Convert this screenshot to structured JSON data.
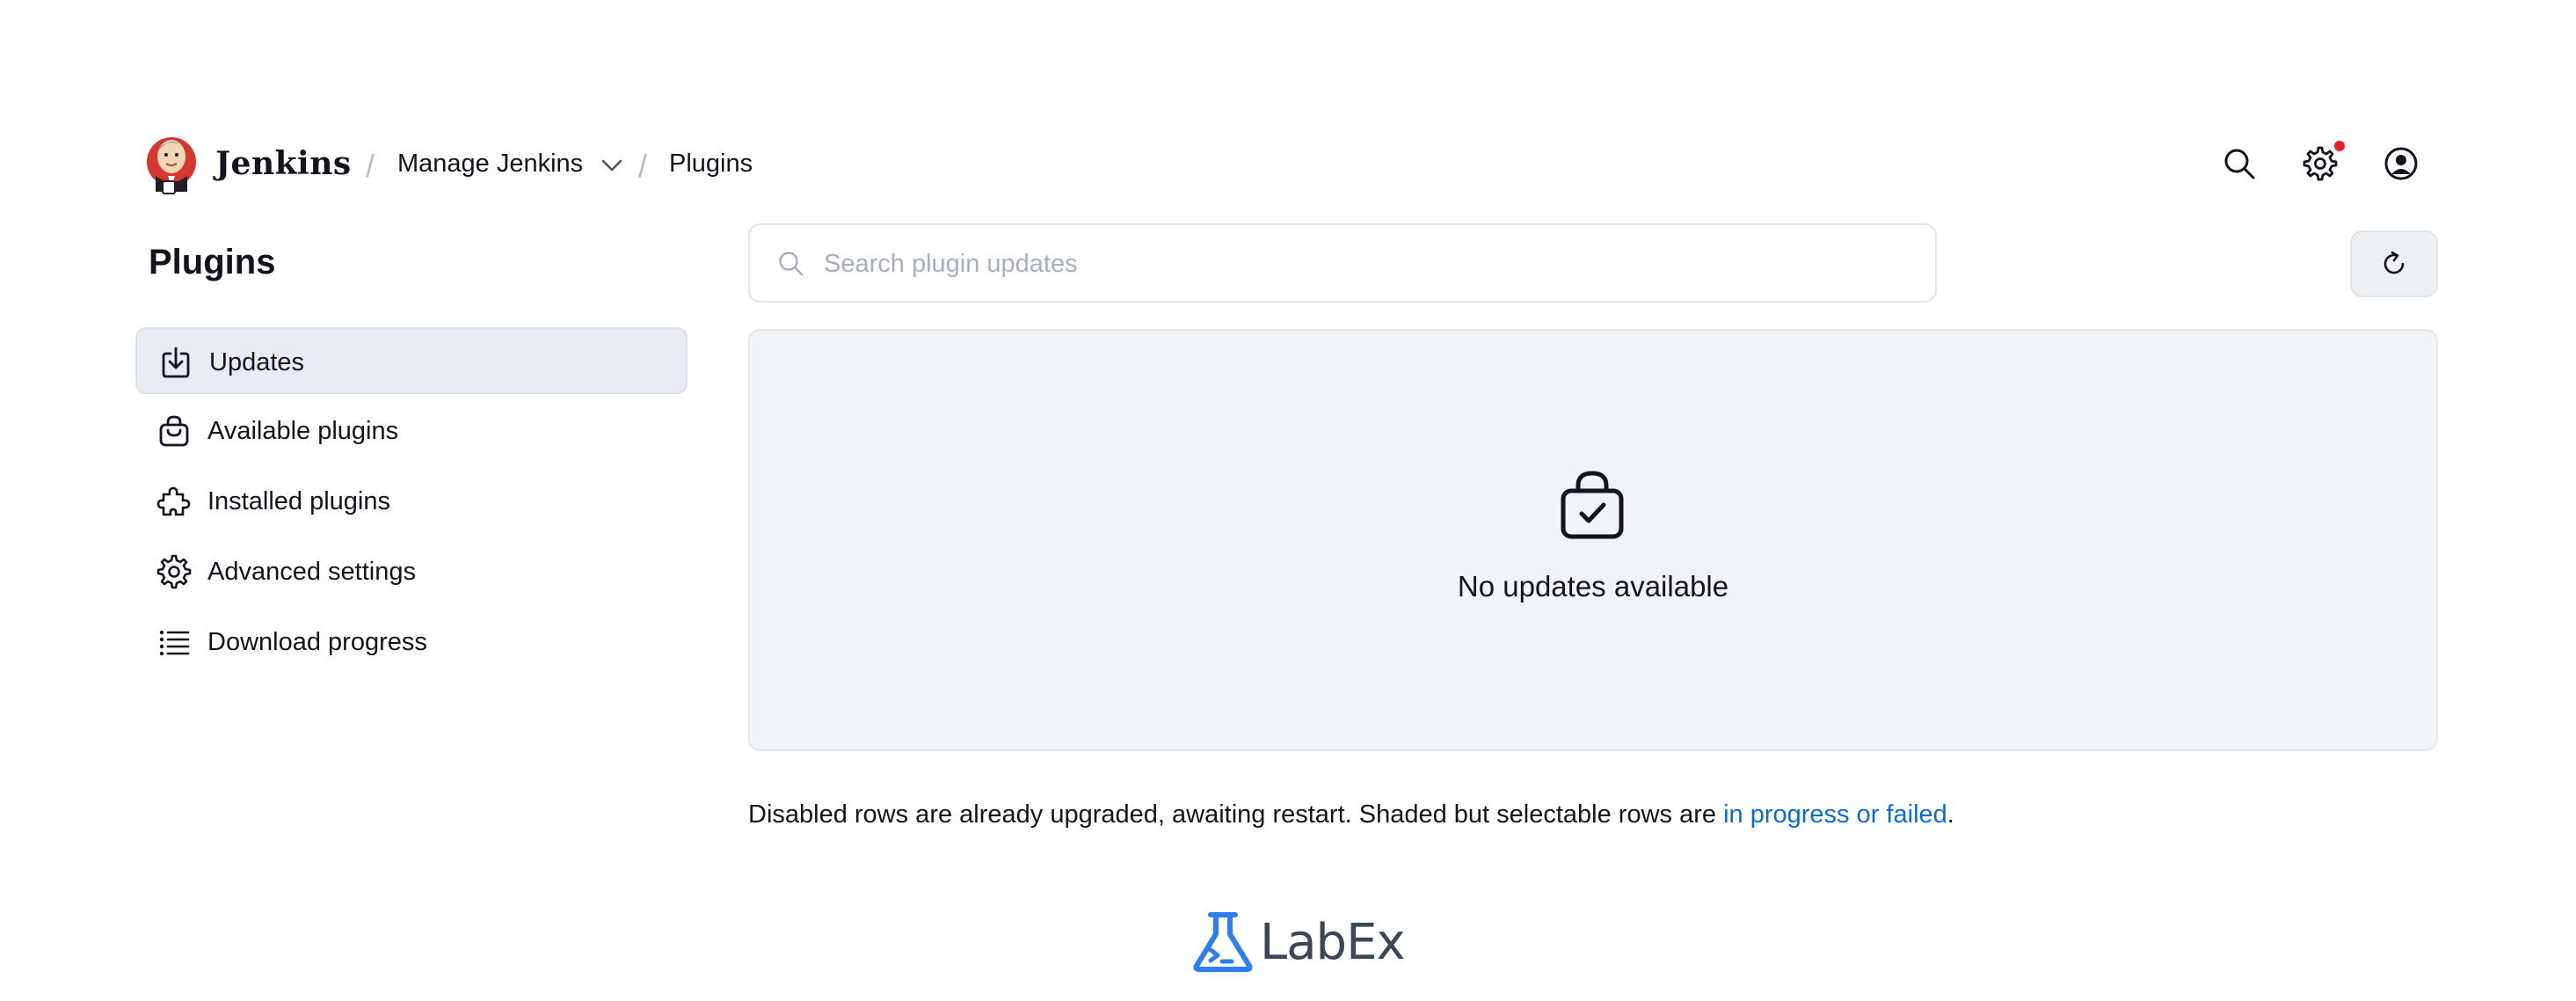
{
  "header": {
    "brand": "Jenkins",
    "breadcrumb": {
      "separator": "/",
      "items": [
        {
          "label": "Manage Jenkins"
        },
        {
          "label": "Plugins"
        }
      ]
    },
    "icons": [
      "search-icon",
      "gear-icon",
      "user-icon"
    ],
    "notification_color": "#e5202e"
  },
  "sidebar": {
    "title": "Plugins",
    "items": [
      {
        "label": "Updates",
        "icon": "download-icon",
        "active": true
      },
      {
        "label": "Available plugins",
        "icon": "shopping-bag-icon",
        "active": false
      },
      {
        "label": "Installed plugins",
        "icon": "puzzle-icon",
        "active": false
      },
      {
        "label": "Advanced settings",
        "icon": "gear-icon",
        "active": false
      },
      {
        "label": "Download progress",
        "icon": "list-icon",
        "active": false
      }
    ]
  },
  "main": {
    "search": {
      "placeholder": "Search plugin updates",
      "value": ""
    },
    "empty_state": {
      "icon": "bag-check-icon",
      "text": "No updates available"
    },
    "footnote": {
      "text": "Disabled rows are already upgraded, awaiting restart. Shaded but selectable rows are ",
      "link": "in progress or failed",
      "end": "."
    }
  },
  "footer": {
    "brand": "LabEx",
    "brand_color": "#2d7ff0"
  },
  "colors": {
    "link": "#0b6bd6",
    "active_bg": "#e8ecf1",
    "panel_bg": "#f1f4f7"
  }
}
